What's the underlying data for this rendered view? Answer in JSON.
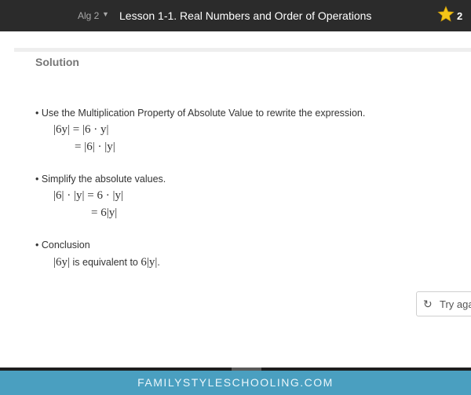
{
  "header": {
    "course": "Alg 2",
    "course_caret": "▼",
    "lesson_title": "Lesson 1-1. Real Numbers and Order of Operations",
    "star_icon": "star-icon",
    "star_count": "2"
  },
  "solution": {
    "heading": "Solution",
    "steps": [
      {
        "text": "Use the Multiplication Property of Absolute Value to rewrite the expression.",
        "lines": [
          "|6y| = |6 · y|",
          "= |6| · |y|"
        ]
      },
      {
        "text": "Simplify the absolute values.",
        "lines": [
          "|6| · |y| = 6 · |y|",
          "= 6|y|"
        ]
      },
      {
        "text": "Conclusion",
        "conclusion": {
          "expr1": "|6y|",
          "middle": " is equivalent to ",
          "expr2": "6|y|",
          "end": "."
        }
      }
    ]
  },
  "try_again": {
    "icon": "refresh-icon",
    "label": "Try aga"
  },
  "footer": {
    "text": "FAMILYSTYLESCHOOLING.COM"
  },
  "colors": {
    "topbar": "#2b2b2b",
    "footer": "#4a9fc0",
    "star": "#f5c518"
  }
}
